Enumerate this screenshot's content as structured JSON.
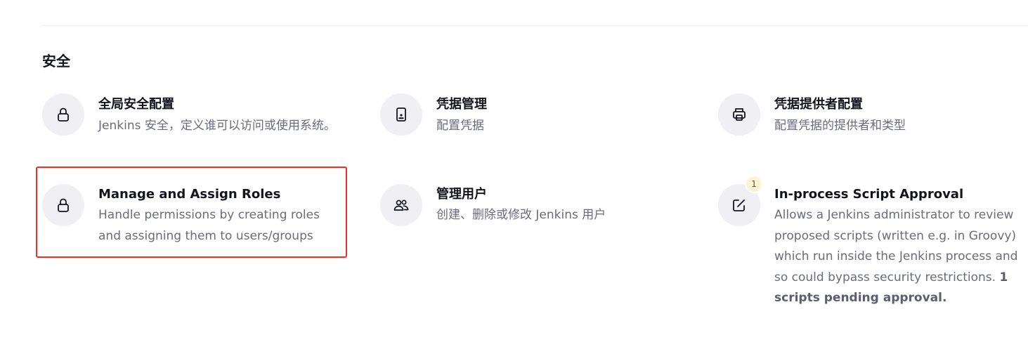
{
  "section": {
    "title": "安全"
  },
  "cards": [
    {
      "title": "全局安全配置",
      "description": "Jenkins 安全，定义谁可以访问或使用系统。",
      "icon": "lock-icon"
    },
    {
      "title": "凭据管理",
      "description": "配置凭据",
      "icon": "phone-badge-icon"
    },
    {
      "title": "凭据提供者配置",
      "description": "配置凭据的提供者和类型",
      "icon": "printer-icon"
    },
    {
      "title": "Manage and Assign Roles",
      "description": "Handle permissions by creating roles and assigning them to users/groups",
      "icon": "lock-icon",
      "highlighted": true,
      "highlight_color": "#e5332a"
    },
    {
      "title": "管理用户",
      "description": "创建、删除或修改 Jenkins 用户",
      "icon": "users-icon"
    },
    {
      "title": "In-process Script Approval",
      "description": "Allows a Jenkins administrator to review proposed scripts (written e.g. in Groovy) which run inside the Jenkins process and so could bypass security restrictions.",
      "description_bold": "1 scripts pending approval.",
      "icon": "edit-square-icon",
      "badge": "1"
    }
  ]
}
